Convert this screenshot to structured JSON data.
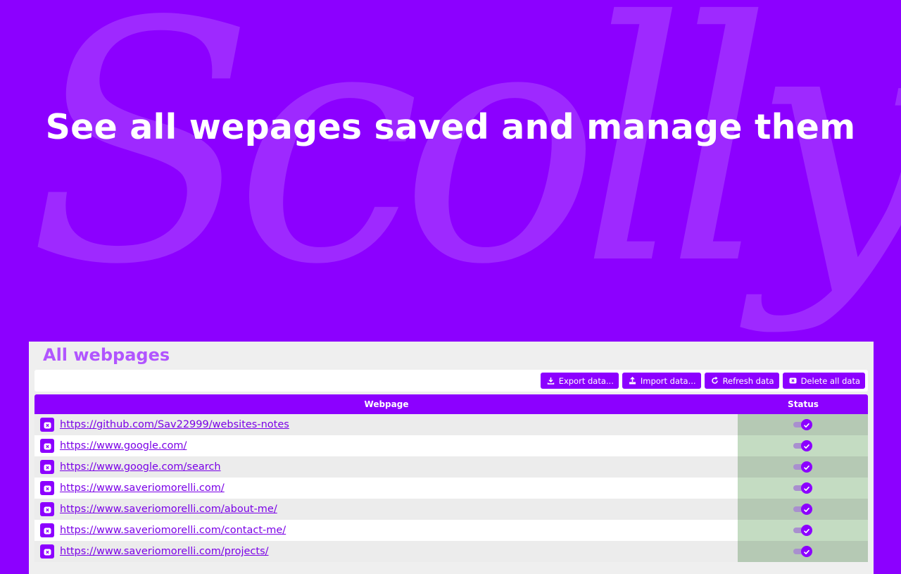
{
  "branding": {
    "watermark_text": "Scolly"
  },
  "headline": "See all wepages saved and manage them",
  "panel": {
    "title": "All webpages",
    "toolbar": {
      "buttons": [
        {
          "label": "Export data...",
          "icon": "export-icon"
        },
        {
          "label": "Import data...",
          "icon": "import-icon"
        },
        {
          "label": "Refresh data",
          "icon": "refresh-icon"
        },
        {
          "label": "Delete all data",
          "icon": "delete-icon"
        }
      ]
    },
    "table": {
      "columns": [
        "Webpage",
        "Status"
      ],
      "rows": [
        {
          "url": "https://github.com/Sav22999/websites-notes",
          "status": "enabled"
        },
        {
          "url": "https://www.google.com/",
          "status": "enabled"
        },
        {
          "url": "https://www.google.com/search",
          "status": "enabled"
        },
        {
          "url": "https://www.saveriomorelli.com/",
          "status": "enabled"
        },
        {
          "url": "https://www.saveriomorelli.com/about-me/",
          "status": "enabled"
        },
        {
          "url": "https://www.saveriomorelli.com/contact-me/",
          "status": "enabled"
        },
        {
          "url": "https://www.saveriomorelli.com/projects/",
          "status": "enabled"
        }
      ]
    }
  },
  "colors": {
    "brand": "#8c00ff",
    "title": "#b155ff",
    "link": "#7a00e6",
    "status_odd": "#b5c9b4",
    "status_even": "#c4dcc2"
  }
}
